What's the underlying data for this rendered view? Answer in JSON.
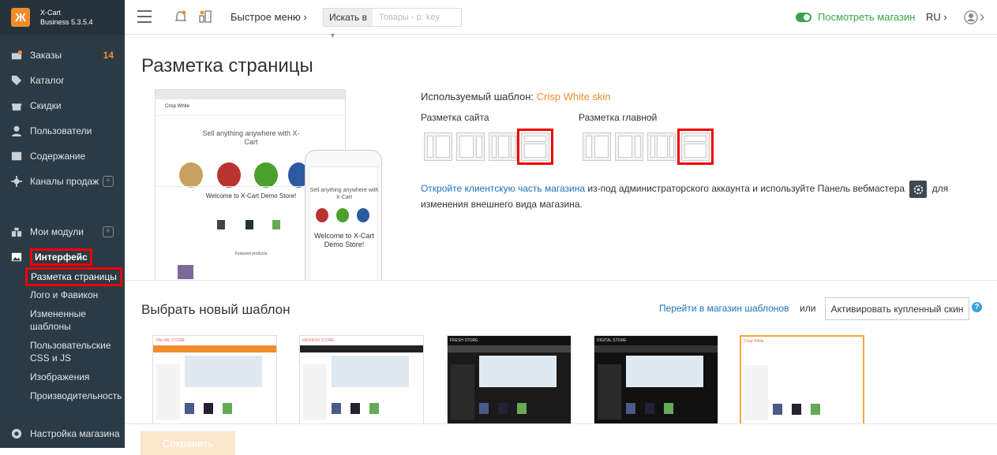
{
  "brand": {
    "logo_letter": "Ж",
    "name": "X-Cart",
    "version": "Business 5.3.5.4"
  },
  "sidebar": {
    "items": [
      {
        "label": "Заказы",
        "icon": "orders-icon",
        "badge": "14"
      },
      {
        "label": "Каталог",
        "icon": "tag-icon"
      },
      {
        "label": "Скидки",
        "icon": "gift-icon"
      },
      {
        "label": "Пользователи",
        "icon": "user-icon"
      },
      {
        "label": "Содержание",
        "icon": "content-icon"
      },
      {
        "label": "Каналы продаж",
        "icon": "channels-icon",
        "plus": "+"
      },
      {
        "label": "Мои модули",
        "icon": "puzzle-icon",
        "plus": "+"
      },
      {
        "label": "Интерфейс",
        "icon": "image-icon"
      },
      {
        "label": "Настройка магазина",
        "icon": "settings-icon"
      }
    ],
    "subitems": [
      "Разметка страницы",
      "Лого и Фавикон",
      "Измененные шаблоны",
      "Пользовательские CSS и JS",
      "Изображения",
      "Производительность"
    ]
  },
  "topbar": {
    "quick_menu": "Быстрое меню ›",
    "search_select": "Искать в",
    "search_placeholder": "Товары - p: key",
    "view_store": "Посмотреть магазин",
    "lang": "RU ›"
  },
  "main": {
    "title": "Разметка страницы",
    "used_template_label": "Используемый шаблон:",
    "used_template_name": "Crisp White skin",
    "site_layout_label": "Разметка сайта",
    "home_layout_label": "Разметка главной",
    "open_store_link": "Откройте клиентскую часть магазина",
    "open_store_text1": " из-под администраторского аккаунта и используйте Панель вебмастера ",
    "open_store_text2": " для изменения внешнего вида магазина.",
    "new_template_title": "Выбрать новый шаблон",
    "go_store_link": "Перейти в магазин шаблонов",
    "or": "или",
    "activate_button": "Активировать купленный скин",
    "help": "?",
    "save_button": "Сохранить"
  },
  "preview": {
    "desk_title": "Crisp White",
    "hero_text": "Sell anything anywhere with X-Cart",
    "welcome": "Welcome to X-Cart Demo Store!",
    "featured": "Featured products",
    "phone_hero": "Sell anything anywhere with X-Cart",
    "phone_welcome": "Welcome to X-Cart Demo Store!"
  },
  "themes": [
    {
      "name": "ONLINE STORE",
      "head_color": "#ffffff",
      "band_color": "#f28c2c",
      "bg": "#ffffff"
    },
    {
      "name": "FASHION STORE",
      "head_color": "#ffffff",
      "band_color": "#222222",
      "bg": "#ffffff"
    },
    {
      "name": "FRESH STORE",
      "head_color": "#111111",
      "band_color": "#444444",
      "bg": "#1a1a1a"
    },
    {
      "name": "DIGITAL STORE",
      "head_color": "#111111",
      "band_color": "#333333",
      "bg": "#111111"
    },
    {
      "name": "Crisp White",
      "head_color": "#ffffff",
      "band_color": "#ffffff",
      "bg": "#ffffff"
    }
  ]
}
